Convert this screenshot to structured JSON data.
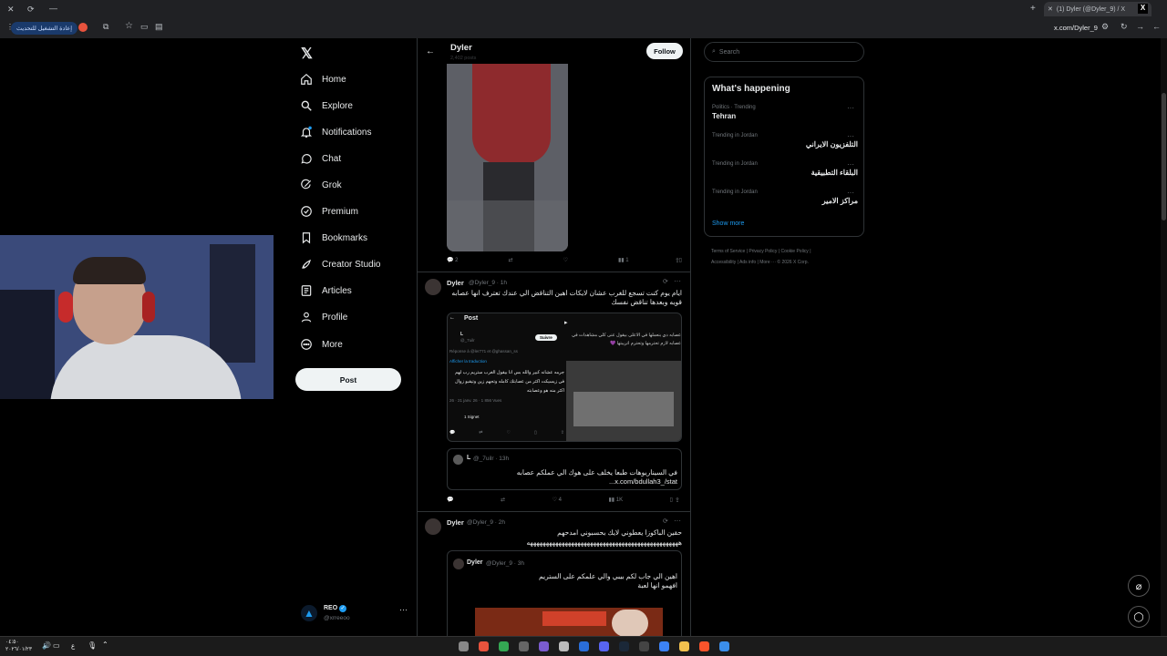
{
  "browser": {
    "tab_title": "(1) Dyler (@Dyler_9) / X",
    "url": "x.com/Dyler_9",
    "update_chip": "إعادة التشغيل للتحديث"
  },
  "nav": {
    "items": [
      {
        "label": "Home",
        "icon": "home-icon"
      },
      {
        "label": "Explore",
        "icon": "search-icon"
      },
      {
        "label": "Notifications",
        "icon": "bell-icon"
      },
      {
        "label": "Chat",
        "icon": "chat-icon"
      },
      {
        "label": "Grok",
        "icon": "grok-icon"
      },
      {
        "label": "Premium",
        "icon": "premium-icon"
      },
      {
        "label": "Bookmarks",
        "icon": "bookmark-icon"
      },
      {
        "label": "Creator Studio",
        "icon": "rocket-icon"
      },
      {
        "label": "Articles",
        "icon": "articles-icon"
      },
      {
        "label": "Profile",
        "icon": "profile-icon"
      },
      {
        "label": "More",
        "icon": "more-icon"
      }
    ],
    "post_button": "Post",
    "account": {
      "name": "REO",
      "handle": "@xrreeoo"
    }
  },
  "header": {
    "name": "Dyler",
    "posts": "2,402 posts",
    "follow": "Follow"
  },
  "tweet1": {
    "replies": "2",
    "views": "1"
  },
  "tweet2": {
    "name": "Dyler",
    "handle": "@Dyler_9 · 1h",
    "text": "ايام يوم كنت تسجع للغرب عشان لايكات اهين التناقض الي عندك تعترف انها عصابه قويه وبعدها تناقض نفسك",
    "embed": {
      "post_label": "Post",
      "follow_label": "Suivre",
      "name": "L",
      "handle": "@_7uilr",
      "text1": "عصابه دي بنعملها في الاعلى بيقول عنى كلي مشاهدات في عصابه لازم تحترمها وتحترم اتريبتها 💜",
      "reply_to": "Réponse à @ler771 et @ghassan_ss",
      "translate": "Afficher la traduction",
      "text2": "جرمه عشانه كبير والله بس انا بيقول الغرب ستريم رب لهم في زيسيكت اكثر من عصابتك كامله وتجهم زين وتيقبو زوال اكثر منه هو وعصابته",
      "meta": "26 · 21 janv. 26 · 1 856 Vues",
      "bookmarks": "1 Signet"
    },
    "quote": {
      "name": "L",
      "handle": "@_7uilr · 13h",
      "text": "في السيناريوهات طبعا يخلف على هوك الي عملكم عصابه",
      "link": "x.com/bdullah3_/stat..."
    },
    "likes": "4",
    "views": "1K"
  },
  "tweet3": {
    "name": "Dyler",
    "handle": "@Dyler_9 · 2h",
    "text": "حقين الباكوزا يعطوني لايك بحسبوني امدحهم",
    "text_b": "ههههههههههههههههههههههههههههههههههههههههههههههههه",
    "quote": {
      "name": "Dyler",
      "handle": "@Dyler_9 · 3h",
      "text": "اهين الي جاب لكم بيبي والي علمكم على الستريم",
      "text_b": "افهمو انها لعبة"
    }
  },
  "search": {
    "placeholder": "Search"
  },
  "trends": {
    "title": "What's happening",
    "items": [
      {
        "context": "Politics · Trending",
        "name": "Tehran"
      },
      {
        "context": "Trending in Jordan",
        "name": "التلفزيون الايراني"
      },
      {
        "context": "Trending in Jordan",
        "name": "البلقاء التطبيقية"
      },
      {
        "context": "Trending in Jordan",
        "name": "مراكز الامير"
      }
    ],
    "show_more": "Show more"
  },
  "footer": {
    "links": [
      "Terms of Service",
      "Privacy Policy",
      "Cookie Policy",
      "Accessibility",
      "Ads info",
      "More ···",
      "© 2026 X Corp."
    ]
  },
  "taskbar": {
    "time": "٠٤:٥٠",
    "date": "٢٠٢٦/٠١/٢٣",
    "lang": "ع"
  }
}
